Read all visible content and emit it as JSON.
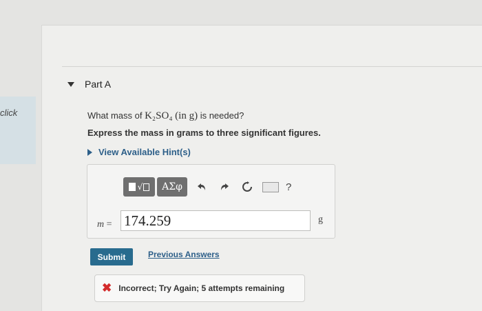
{
  "sidebar": {
    "click_label": "click"
  },
  "part": {
    "title": "Part A"
  },
  "question": {
    "prefix": "What mass of ",
    "formula": "K₂SO₄",
    "unit_note": "(in g)",
    "suffix": " is needed?",
    "instruction": "Express the mass in grams to three significant figures."
  },
  "hints": {
    "label": "View Available Hint(s)"
  },
  "toolbar": {
    "templates_icon": "templates-icon",
    "symbols_label": "ΑΣφ",
    "undo_icon": "undo-icon",
    "redo_icon": "redo-icon",
    "reset_icon": "reset-icon",
    "keyboard_icon": "keyboard-icon",
    "help_label": "?"
  },
  "answer": {
    "variable": "m",
    "equals": "=",
    "value": "174.259",
    "unit": "g"
  },
  "actions": {
    "submit_label": "Submit",
    "previous_answers_label": "Previous Answers"
  },
  "feedback": {
    "icon": "x-icon",
    "text": "Incorrect; Try Again; 5 attempts remaining",
    "color": "#d32b2b"
  }
}
